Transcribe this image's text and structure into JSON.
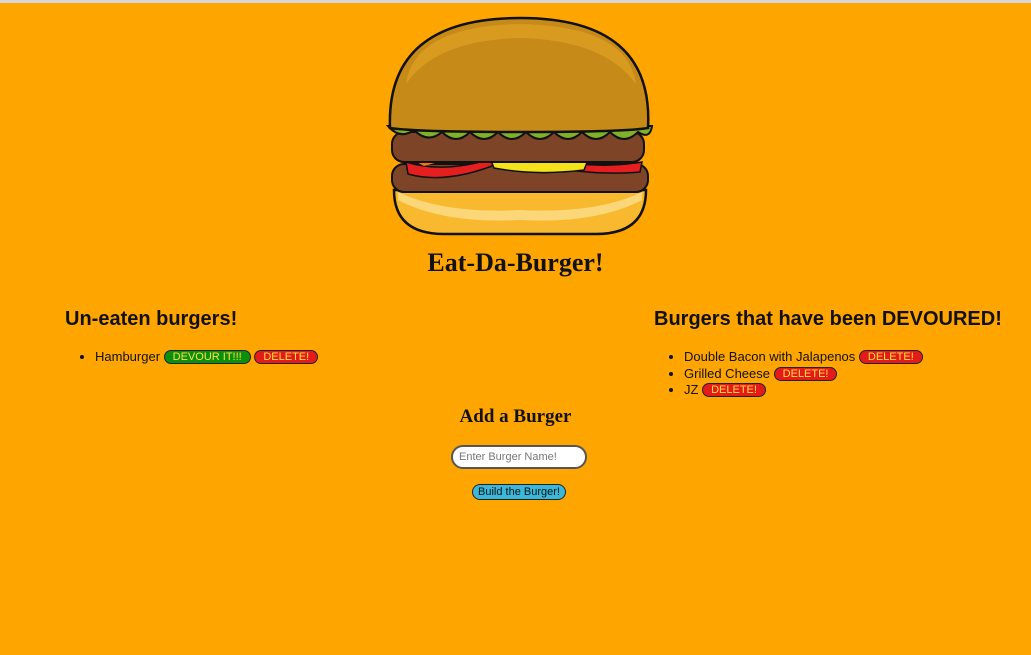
{
  "header": {
    "title": "Eat-Da-Burger!",
    "logo_icon": "burger-logo-icon"
  },
  "uneaten": {
    "title": "Un-eaten burgers!",
    "items": [
      {
        "name": "Hamburger",
        "devour_label": "DEVOUR IT!!!",
        "delete_label": "DELETE!"
      }
    ]
  },
  "devoured": {
    "title": "Burgers that have been DEVOURED!",
    "items": [
      {
        "name": "Double Bacon with Jalapenos",
        "delete_label": "DELETE!"
      },
      {
        "name": "Grilled Cheese",
        "delete_label": "DELETE!"
      },
      {
        "name": "JZ",
        "delete_label": "DELETE!"
      }
    ]
  },
  "add_form": {
    "title": "Add a Burger",
    "placeholder": "Enter Burger Name!",
    "value": "",
    "submit_label": "Build the Burger!"
  },
  "colors": {
    "background": "#ffa500",
    "devour_button": "#0c8f0c",
    "delete_button": "#e31b1b",
    "button_text": "#ffe23a",
    "submit_button": "#3ab8da"
  }
}
